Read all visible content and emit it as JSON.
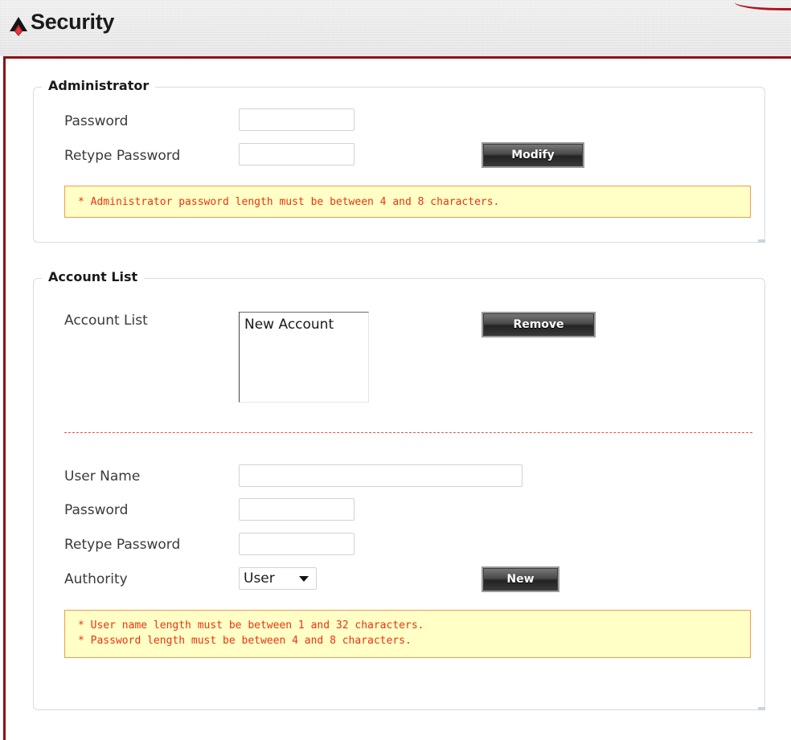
{
  "header": {
    "title": "Security",
    "logo_icon": "security-logo-icon"
  },
  "administrator": {
    "legend": "Administrator",
    "password_label": "Password",
    "password_value": "",
    "retype_label": "Retype Password",
    "retype_value": "",
    "modify_label": "Modify",
    "note": "* Administrator password length must be between 4 and 8 characters."
  },
  "accounts": {
    "legend": "Account List",
    "list_label": "Account List",
    "list_items": [
      "New Account"
    ],
    "remove_label": "Remove",
    "username_label": "User Name",
    "username_value": "",
    "password_label": "Password",
    "password_value": "",
    "retype_label": "Retype Password",
    "retype_value": "",
    "authority_label": "Authority",
    "authority_value": "User",
    "new_label": "New",
    "notes": [
      "* User name length must be between 1 and 32 characters.",
      "* Password length must be between 4 and 8 characters."
    ]
  },
  "colors": {
    "accent": "#8f0f16",
    "note_bg": "#ffffc6",
    "note_border": "#f29b4f",
    "note_text": "#ee3311"
  }
}
